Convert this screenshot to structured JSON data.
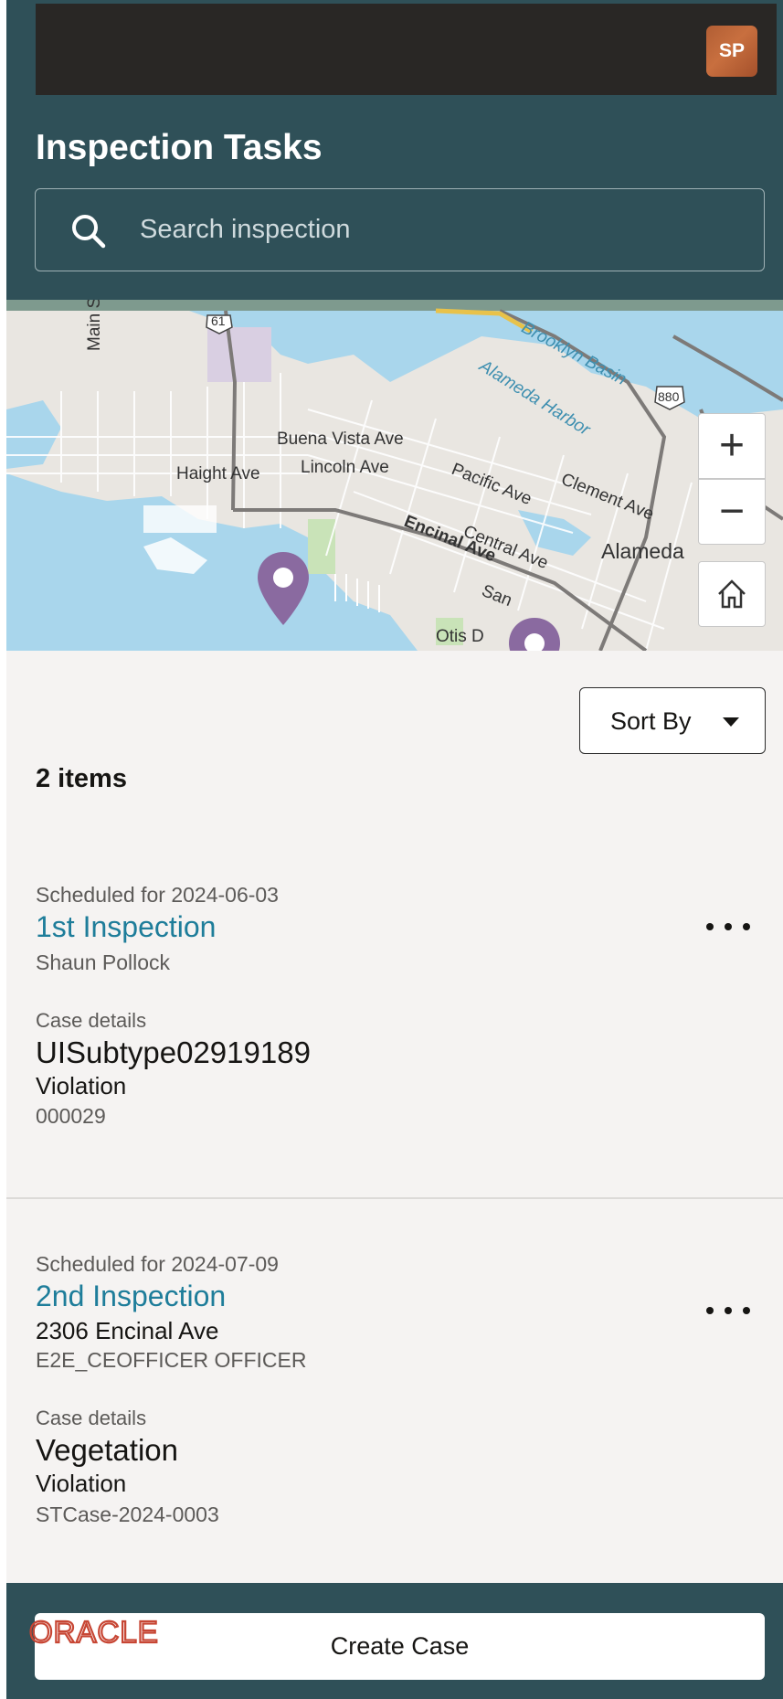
{
  "header": {
    "avatar_initials": "SP",
    "title": "Inspection Tasks",
    "search_placeholder": "Search inspection"
  },
  "map": {
    "labels": {
      "main_st": "Main St",
      "route_61": "61",
      "route_880": "880",
      "brooklyn_basin": "Brooklyn Basin",
      "alameda_harbor": "Alameda Harbor",
      "buena_vista": "Buena Vista Ave",
      "lincoln": "Lincoln Ave",
      "haight": "Haight Ave",
      "pacific": "Pacific Ave",
      "clement": "Clement Ave",
      "encinal": "Encinal Ave",
      "central": "Central Ave",
      "alameda": "Alameda",
      "san": "San",
      "otis": "Otis D"
    },
    "controls": {
      "zoom_in": "+",
      "zoom_out": "−"
    }
  },
  "list": {
    "sort_label": "Sort By",
    "count_label": "2 items",
    "items": [
      {
        "scheduled": "Scheduled for 2024-06-03",
        "title": "1st Inspection",
        "line1": "Shaun Pollock",
        "case_label": "Case details",
        "case_title": "UISubtype02919189",
        "case_type": "Violation",
        "case_id": "000029"
      },
      {
        "scheduled": "Scheduled for 2024-07-09",
        "title": "2nd Inspection",
        "line1": "2306 Encinal Ave",
        "line2": "E2E_CEOFFICER OFFICER",
        "case_label": "Case details",
        "case_title": "Vegetation",
        "case_type": "Violation",
        "case_id": "STCase-2024-0003"
      }
    ]
  },
  "footer": {
    "logo_text": "ORACLE",
    "create_case_label": "Create Case"
  },
  "colors": {
    "header_bg": "#2f5058",
    "topbar_bg": "#292725",
    "link": "#1e7d9a",
    "pin": "#8a6aa0",
    "oracle_red": "#c74634",
    "page_bg": "#f5f3f2"
  }
}
